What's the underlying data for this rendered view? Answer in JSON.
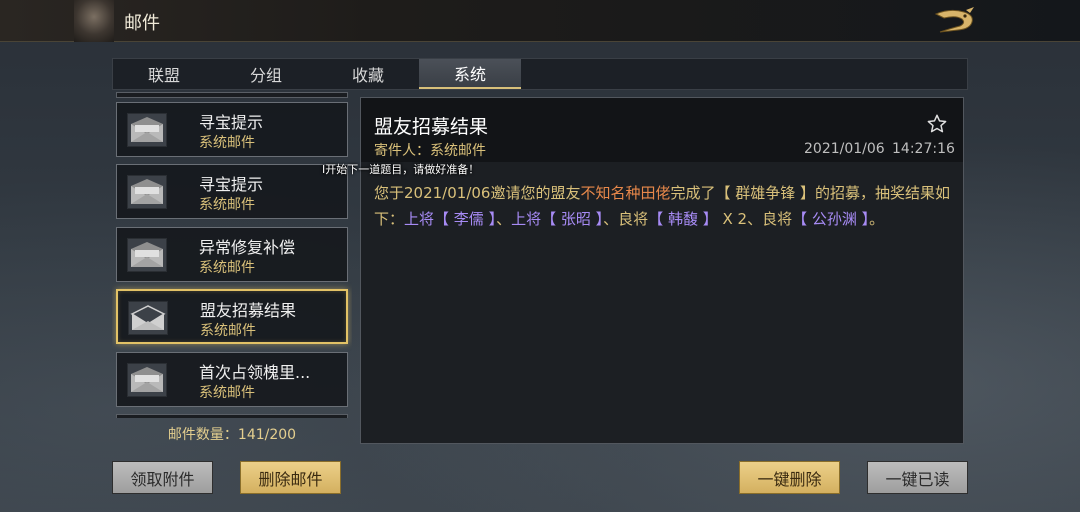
{
  "header": {
    "title": "邮件"
  },
  "tabs": [
    {
      "label": "联盟"
    },
    {
      "label": "分组"
    },
    {
      "label": "收藏"
    },
    {
      "label": "系统"
    }
  ],
  "active_tab": "系统",
  "mail_list": {
    "items": [
      {
        "title": "寻宝提示",
        "sender": "系统邮件",
        "opened": false,
        "selected": false
      },
      {
        "title": "寻宝提示",
        "sender": "系统邮件",
        "opened": false,
        "selected": false
      },
      {
        "title": "异常修复补偿",
        "sender": "系统邮件",
        "opened": false,
        "selected": false
      },
      {
        "title": "盟友招募结果",
        "sender": "系统邮件",
        "opened": true,
        "selected": true
      },
      {
        "title": "首次占领槐里...",
        "sender": "系统邮件",
        "opened": false,
        "selected": false
      }
    ],
    "count_label": "邮件数量：141/200"
  },
  "detail": {
    "title": "盟友招募结果",
    "sender_line": "寄件人：系统邮件",
    "date": "2021/01/06",
    "time": "14:27:16",
    "body": {
      "p1": "您于2021/01/06邀请您的盟友",
      "ally_name": "不知名种田佬",
      "p2": "完成了【 群雄争锋 】的招募，抽奖结果如下：",
      "rank1": "上将",
      "hero1": "【 李儒 】",
      "sep1": "、",
      "rank2": "上将",
      "hero2": "【 张昭 】",
      "sep2": "、",
      "rank3": "良将",
      "hero3": "【 韩馥 】",
      "mult3": " X 2",
      "sep3": "、",
      "rank4": "良将",
      "hero4": "【 公孙渊 】",
      "end": "。"
    }
  },
  "toast": "I开始下一道题目，请做好准备！",
  "buttons": {
    "claim_attachments": "领取附件",
    "delete_mail": "删除邮件",
    "delete_all": "一键删除",
    "read_all": "一键已读"
  },
  "colors": {
    "gold_text": "#d9c07a",
    "highlight_orange": "#e8884a",
    "highlight_purple": "#a78bf5",
    "selected_border": "#e2c266"
  }
}
